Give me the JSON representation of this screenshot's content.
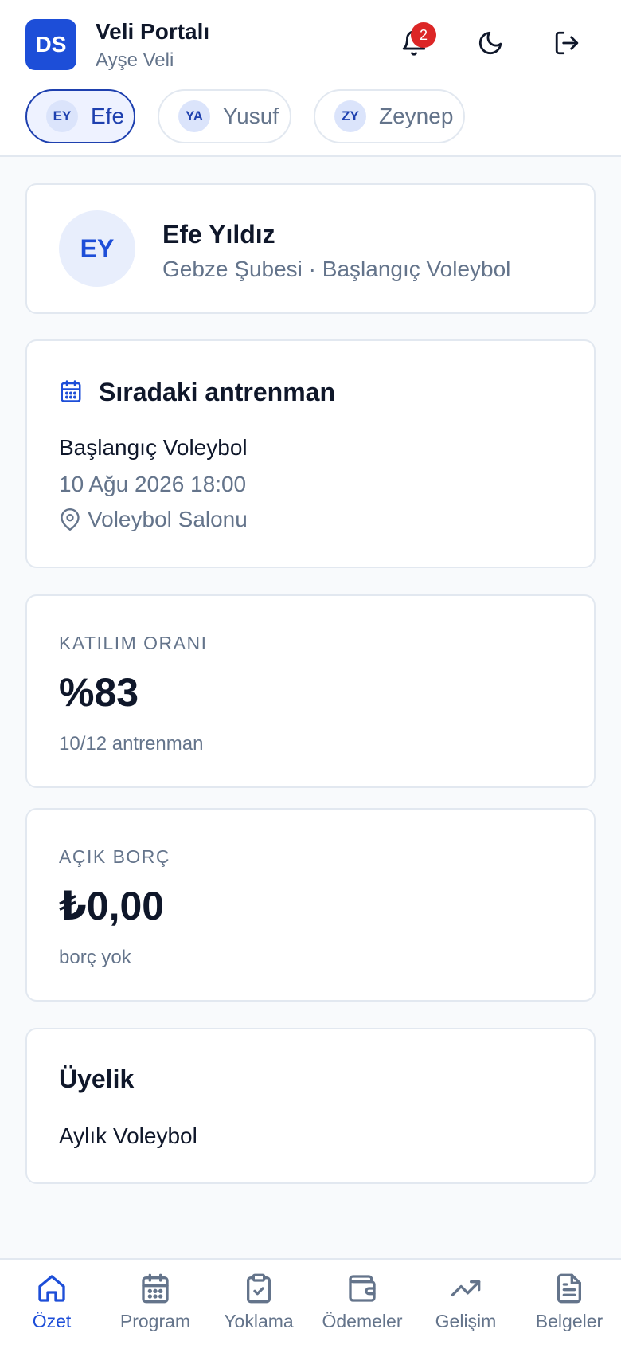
{
  "header": {
    "logo_initials": "DS",
    "title": "Veli Portalı",
    "user": "Ayşe Veli",
    "notification_count": "2",
    "icons": [
      "bell-icon",
      "moon-icon",
      "logout-icon"
    ]
  },
  "children": [
    {
      "initials": "EY",
      "name": "Efe",
      "active": true
    },
    {
      "initials": "YA",
      "name": "Yusuf",
      "active": false
    },
    {
      "initials": "ZY",
      "name": "Zeynep",
      "active": false
    }
  ],
  "profile": {
    "initials": "EY",
    "name": "Efe Yıldız",
    "subtitle": "Gebze Şubesi · Başlangıç Voleybol"
  },
  "next_training": {
    "title": "Sıradaki antrenman",
    "program": "Başlangıç Voleybol",
    "datetime": "10 Ağu 2026 18:00",
    "location": "Voleybol Salonu"
  },
  "attendance": {
    "label": "KATILIM ORANI",
    "value": "%83",
    "sub": "10/12 antrenman"
  },
  "debt": {
    "label": "AÇIK BORÇ",
    "value": "₺0,00",
    "sub": "borç yok"
  },
  "membership": {
    "title": "Üyelik",
    "plan": "Aylık Voleybol"
  },
  "nav": [
    {
      "label": "Özet",
      "icon": "home-icon",
      "active": true
    },
    {
      "label": "Program",
      "icon": "calendar-icon",
      "active": false
    },
    {
      "label": "Yoklama",
      "icon": "clipboard-check-icon",
      "active": false
    },
    {
      "label": "Ödemeler",
      "icon": "wallet-icon",
      "active": false
    },
    {
      "label": "Gelişim",
      "icon": "trending-up-icon",
      "active": false
    },
    {
      "label": "Belgeler",
      "icon": "document-icon",
      "active": false
    }
  ],
  "colors": {
    "accent": "#1d4ed8",
    "badge": "#dc2626",
    "muted": "#64748b"
  }
}
